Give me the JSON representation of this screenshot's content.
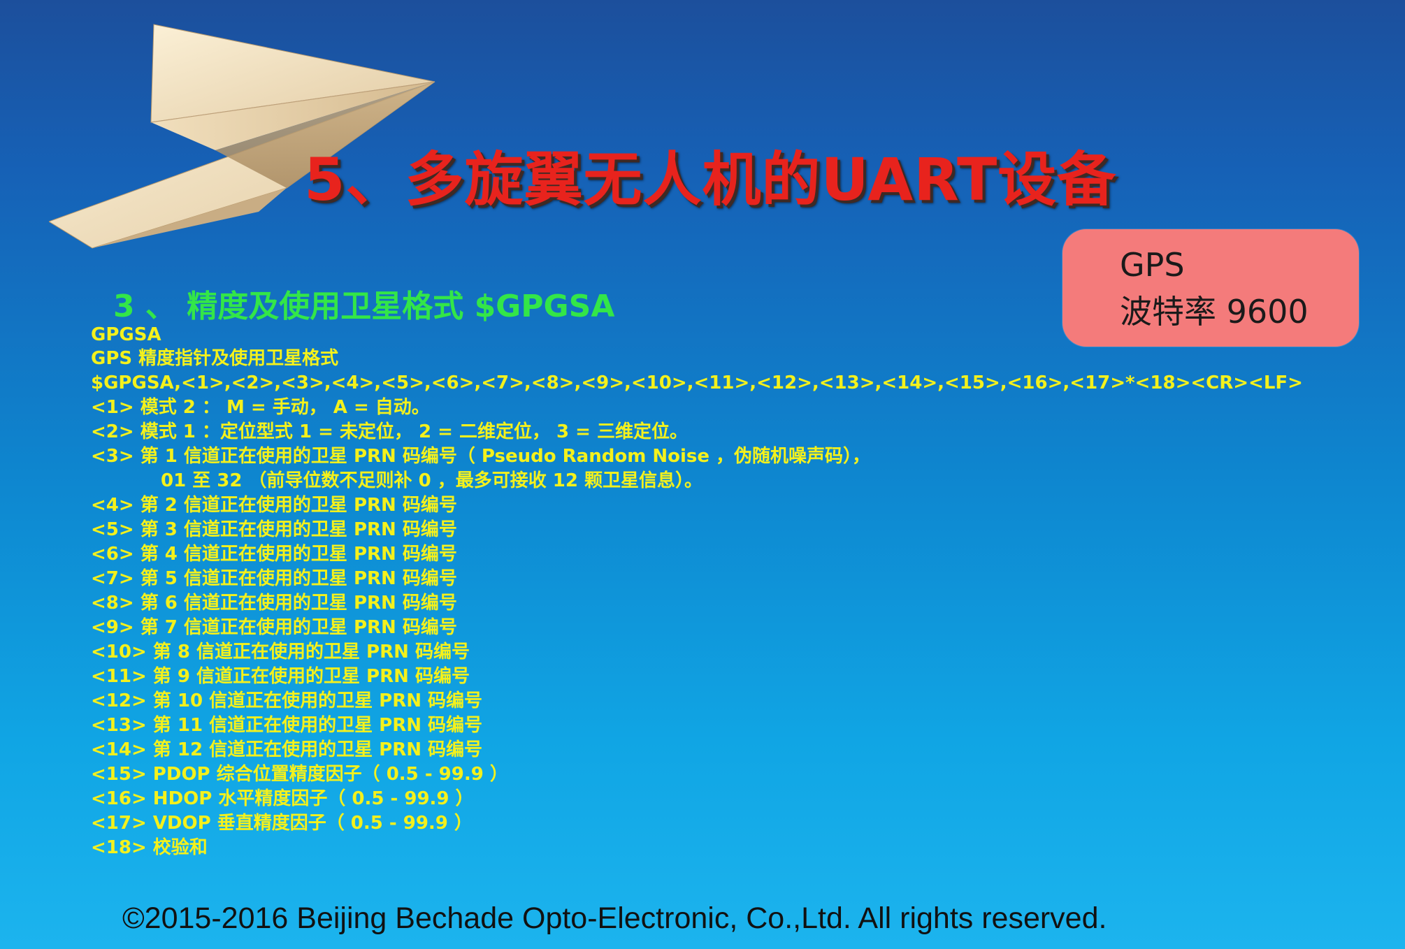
{
  "title": "5、多旋翼无人机的UART设备",
  "gps_box": {
    "line1": "GPS",
    "line2": "波特率 9600"
  },
  "subtitle": "3 、 精度及使用卫星格式 $GPGSA",
  "lines": [
    "GPGSA",
    "GPS 精度指针及使用卫星格式",
    "$GPGSA,<1>,<2>,<3>,<4>,<5>,<6>,<7>,<8>,<9>,<10>,<11>,<12>,<13>,<14>,<15>,<16>,<17>*<18><CR><LF>",
    "<1>  模式 2 ： M = 手动， A = 自动。",
    "<2>  模式 1 ：定位型式 1 = 未定位， 2 = 二维定位， 3 = 三维定位。",
    "<3>  第 1 信道正在使用的卫星 PRN 码编号（ Pseudo Random Noise ，伪随机噪声码），",
    "01 至 32 （前导位数不足则补 0 ，最多可接收 12 颗卫星信息）。",
    "<4>  第 2 信道正在使用的卫星 PRN 码编号",
    "<5>  第 3 信道正在使用的卫星 PRN 码编号",
    "<6>  第 4 信道正在使用的卫星 PRN 码编号",
    "<7>  第 5 信道正在使用的卫星 PRN 码编号",
    "<8>  第 6 信道正在使用的卫星 PRN 码编号",
    "<9>  第 7 信道正在使用的卫星 PRN 码编号",
    "<10>  第 8 信道正在使用的卫星 PRN 码编号",
    "<11>  第 9 信道正在使用的卫星 PRN 码编号",
    "<12>  第 10 信道正在使用的卫星 PRN 码编号",
    "<13>  第 11 信道正在使用的卫星 PRN 码编号",
    "<14>  第 12 信道正在使用的卫星 PRN 码编号",
    "<15> PDOP 综合位置精度因子（ 0.5 - 99.9 ）",
    "<16> HDOP 水平精度因子（ 0.5 - 99.9 ）",
    "<17> VDOP 垂直精度因子（ 0.5 - 99.9 ）",
    "<18>  校验和"
  ],
  "footer": "©2015-2016 Beijing Bechade Opto-Electronic, Co.,Ltd. All rights reserved.",
  "colors": {
    "title": "#e8231d",
    "subtitle": "#33e648",
    "body_text": "#f4f11c",
    "gps_box": "#f47b7b"
  },
  "decorations": {
    "plane": "paper-airplane-illustration"
  }
}
